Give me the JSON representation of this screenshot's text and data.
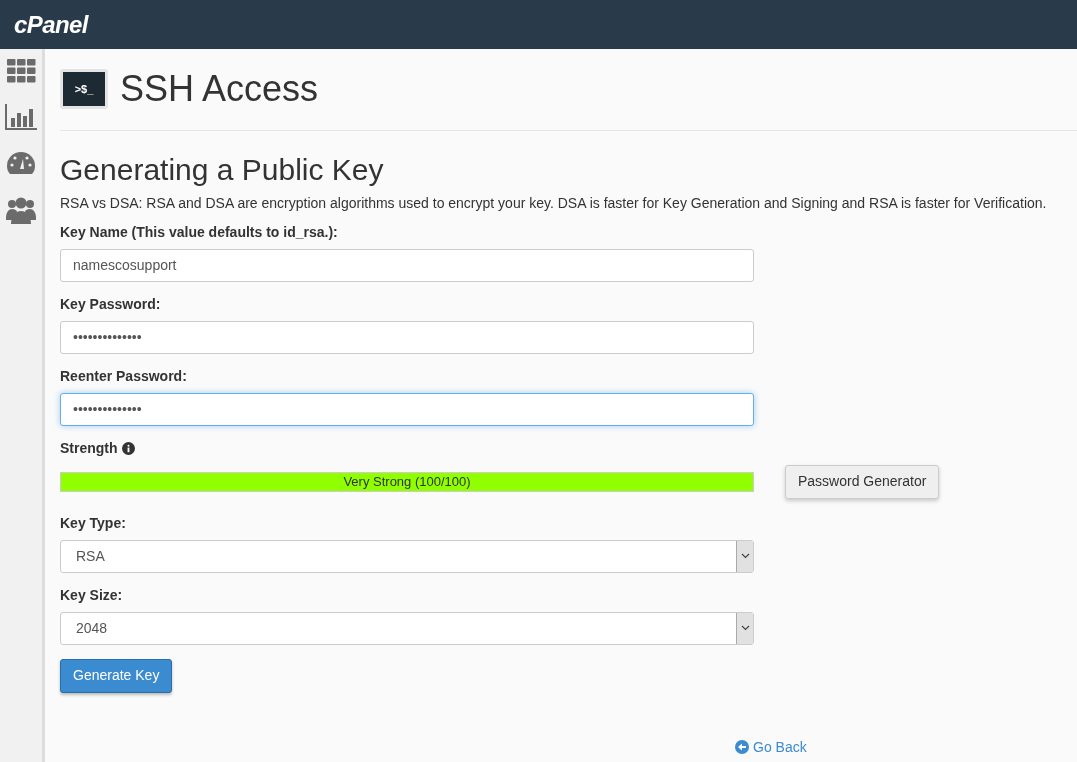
{
  "header": {
    "logo": "cPanel"
  },
  "page": {
    "icon_text": ">$_",
    "title": "SSH Access"
  },
  "form": {
    "heading": "Generating a Public Key",
    "description": "RSA vs DSA: RSA and DSA are encryption algorithms used to encrypt your key. DSA is faster for Key Generation and Signing and RSA is faster for Verification.",
    "fields": [
      {
        "kind": "text",
        "label": "Key Name (This value defaults to id_rsa.):",
        "value": "namescosupport",
        "focused": false
      },
      {
        "kind": "text",
        "label": "Key Password:",
        "value": "••••••••••••••",
        "focused": false
      },
      {
        "kind": "text",
        "label": "Reenter Password:",
        "value": "••••••••••••••",
        "focused": true
      },
      {
        "kind": "meter",
        "label": "Strength",
        "level": 1.0,
        "reading": "Very Strong (100/100)",
        "button": "Password Generator"
      },
      {
        "kind": "select",
        "label": "Key Type:",
        "value": "RSA"
      },
      {
        "kind": "select",
        "label": "Key Size:",
        "value": "2048"
      }
    ],
    "submit": "Generate Key"
  },
  "go_back": "Go Back"
}
